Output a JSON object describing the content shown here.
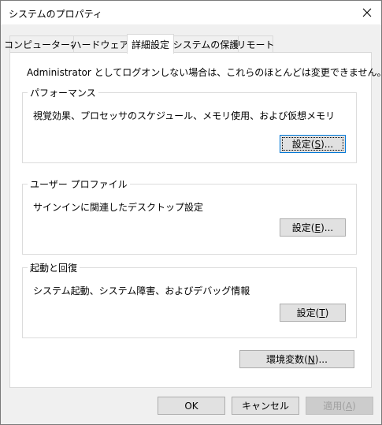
{
  "window": {
    "title": "システムのプロパティ"
  },
  "tabs": [
    {
      "label": "コンピューター名",
      "active": false
    },
    {
      "label": "ハードウェア",
      "active": false
    },
    {
      "label": "詳細設定",
      "active": true
    },
    {
      "label": "システムの保護",
      "active": false
    },
    {
      "label": "リモート",
      "active": false
    }
  ],
  "panel": {
    "intro": "Administrator としてログオンしない場合は、これらのほとんどは変更できません。",
    "performance": {
      "title": "パフォーマンス",
      "description": "視覚効果、プロセッサのスケジュール、メモリ使用、および仮想メモリ",
      "button": {
        "label": "設定(",
        "mnemonic": "S",
        "suffix": ")..."
      }
    },
    "user_profile": {
      "title": "ユーザー プロファイル",
      "description": "サインインに関連したデスクトップ設定",
      "button": {
        "label": "設定(",
        "mnemonic": "E",
        "suffix": ")..."
      }
    },
    "startup": {
      "title": "起動と回復",
      "description": "システム起動、システム障害、およびデバッグ情報",
      "button": {
        "label": "設定(",
        "mnemonic": "T",
        "suffix": ")"
      }
    },
    "env_button": {
      "label": "環境変数(",
      "mnemonic": "N",
      "suffix": ")..."
    }
  },
  "footer": {
    "ok": "OK",
    "cancel": "キャンセル",
    "apply": {
      "label": "適用(",
      "mnemonic": "A",
      "suffix": ")"
    }
  },
  "icons": {
    "close": "close-icon"
  }
}
